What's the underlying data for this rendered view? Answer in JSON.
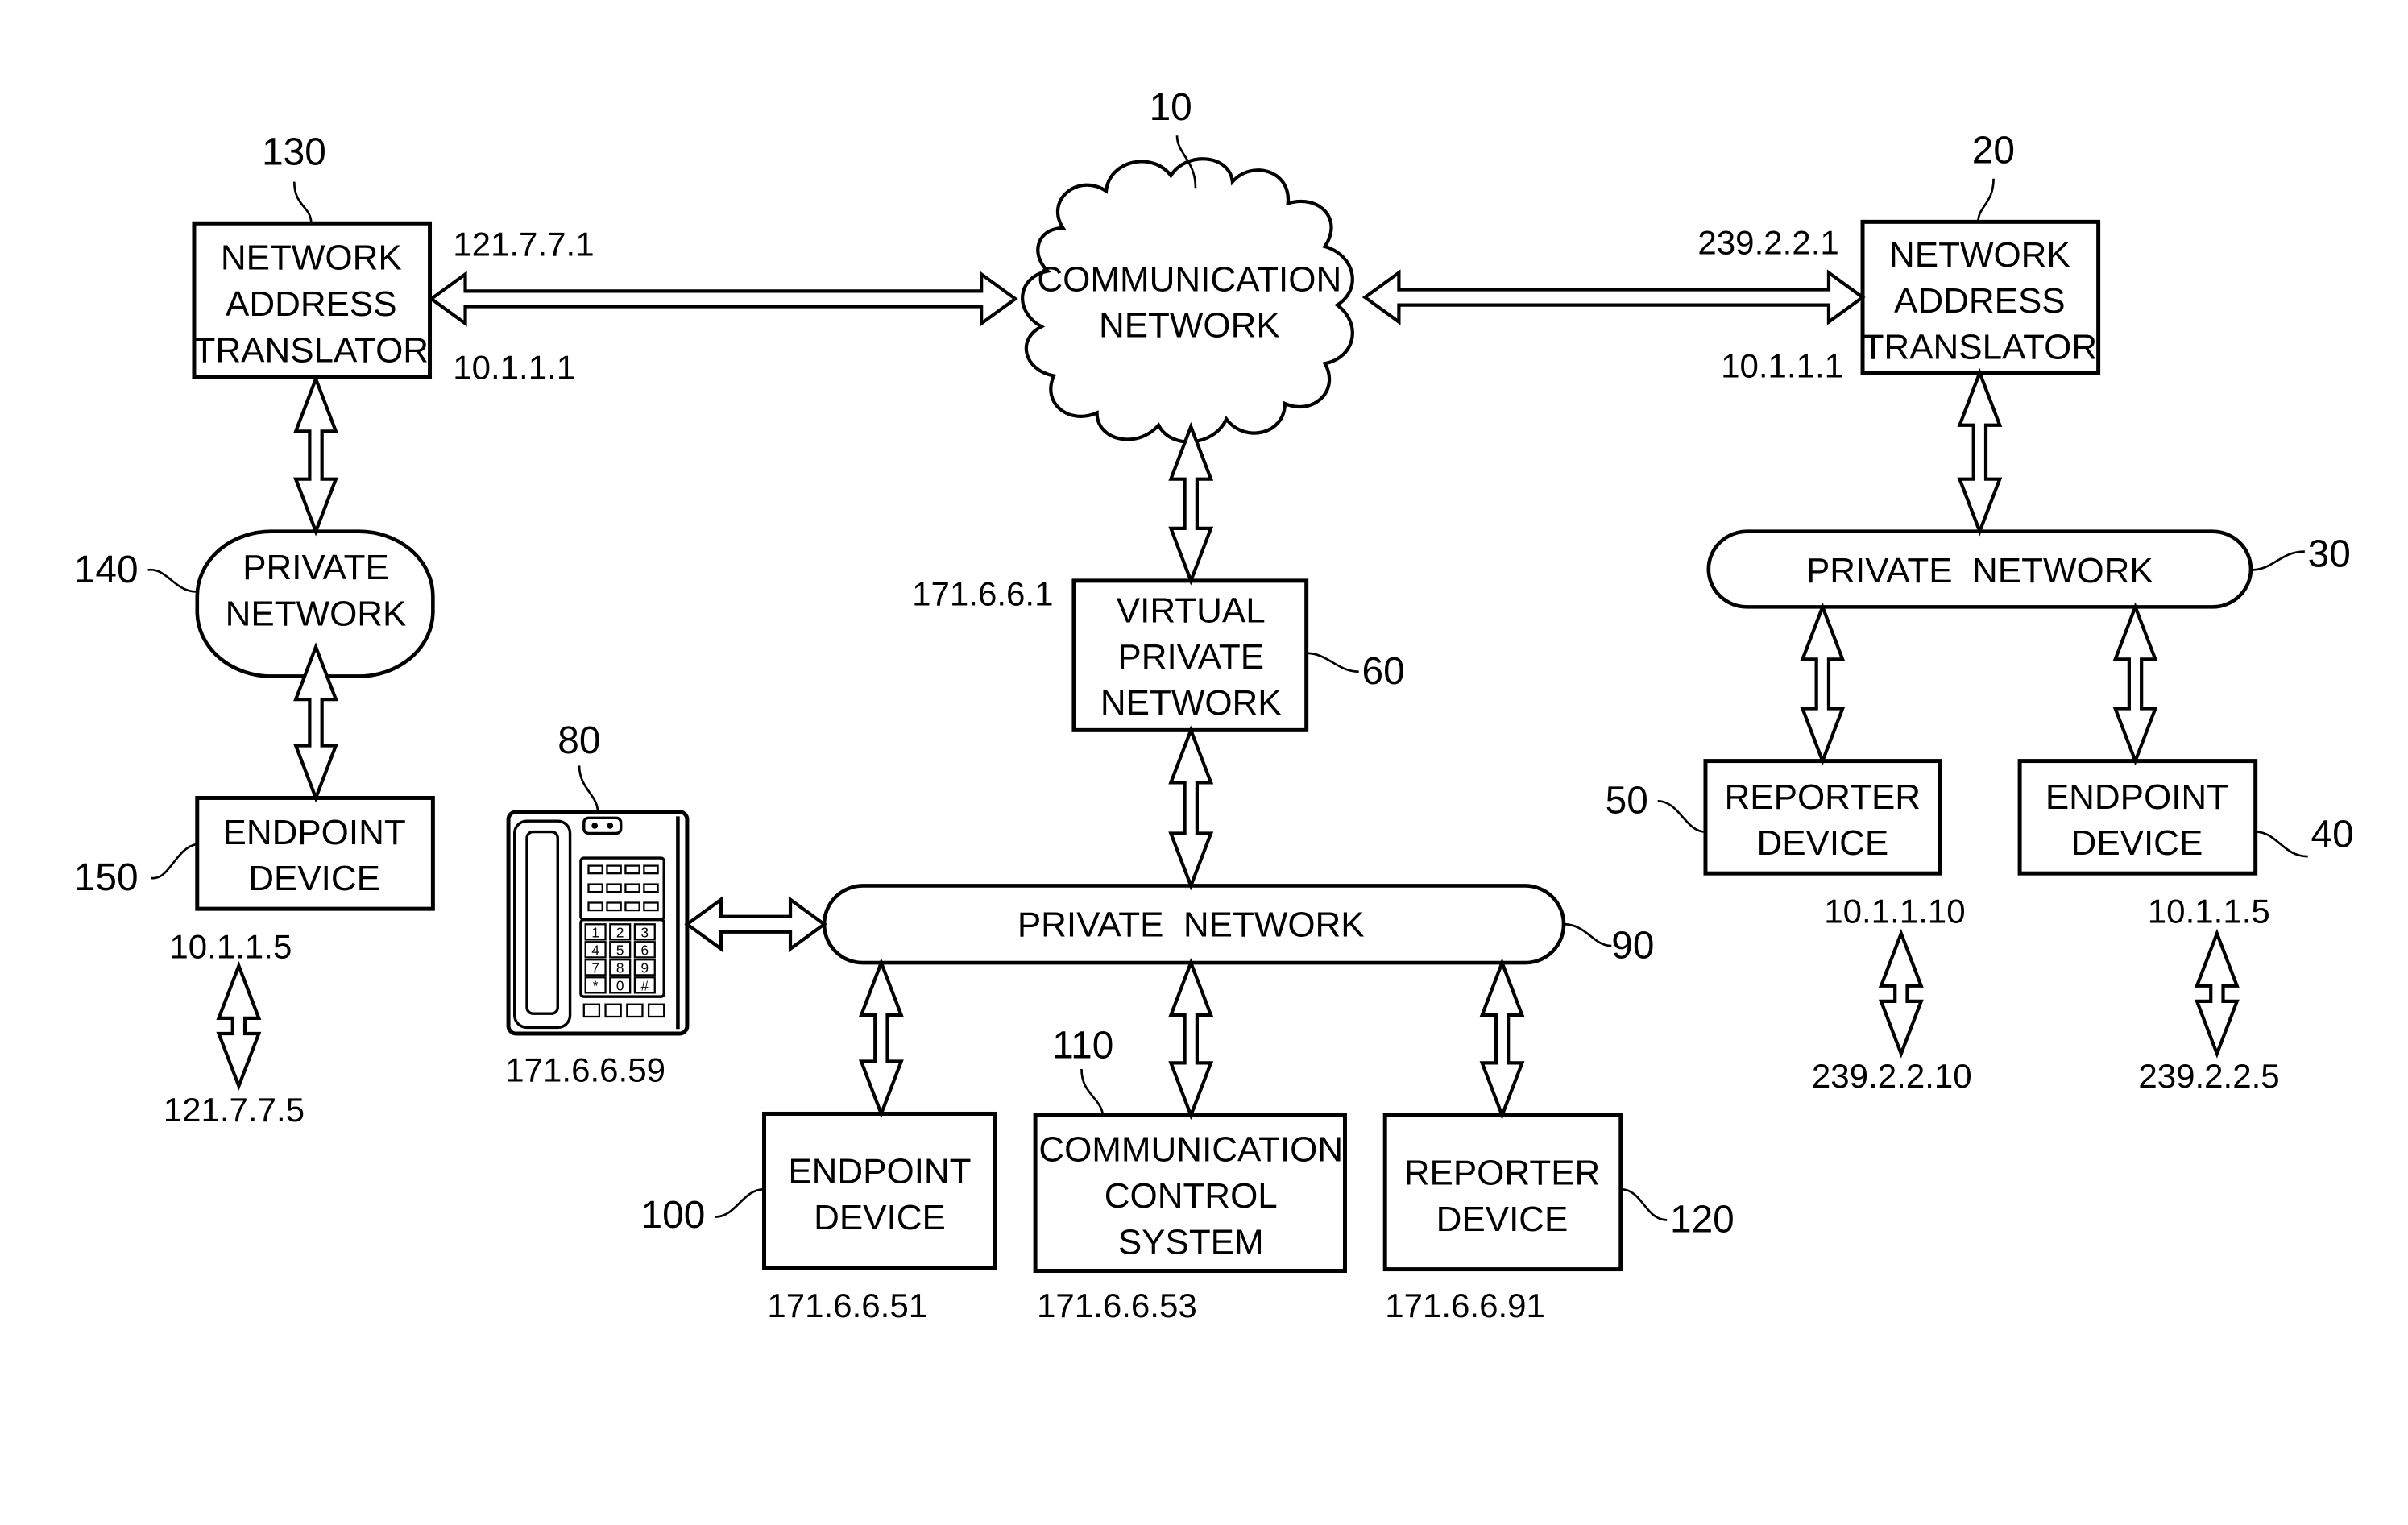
{
  "nodes": {
    "communication_network": {
      "ref": "10",
      "lines": [
        "COMMUNICATION",
        "NETWORK"
      ]
    },
    "nat_right": {
      "ref": "20",
      "lines": [
        "NETWORK",
        "ADDRESS",
        "TRANSLATOR"
      ],
      "ip_public": "239.2.2.1",
      "ip_private": "10.1.1.1"
    },
    "private_network_right": {
      "ref": "30",
      "lines": [
        "PRIVATE  NETWORK"
      ]
    },
    "endpoint_right": {
      "ref": "40",
      "lines": [
        "ENDPOINT",
        "DEVICE"
      ],
      "ip_private": "10.1.1.5",
      "ip_public": "239.2.2.5"
    },
    "reporter_right": {
      "ref": "50",
      "lines": [
        "REPORTER",
        "DEVICE"
      ],
      "ip_private": "10.1.1.10",
      "ip_public": "239.2.2.10"
    },
    "vpn": {
      "ref": "60",
      "lines": [
        "VIRTUAL",
        "PRIVATE",
        "NETWORK"
      ],
      "ip": "171.6.6.1"
    },
    "phone": {
      "ref": "80",
      "ip": "171.6.6.59",
      "keys": [
        "1",
        "2",
        "3",
        "4",
        "5",
        "6",
        "7",
        "8",
        "9",
        "*",
        "0",
        "#"
      ]
    },
    "private_network_center": {
      "ref": "90",
      "lines": [
        "PRIVATE  NETWORK"
      ]
    },
    "endpoint_center": {
      "ref": "100",
      "lines": [
        "ENDPOINT",
        "DEVICE"
      ],
      "ip": "171.6.6.51"
    },
    "comm_control": {
      "ref": "110",
      "lines": [
        "COMMUNICATION",
        "CONTROL",
        "SYSTEM"
      ],
      "ip": "171.6.6.53"
    },
    "reporter_center": {
      "ref": "120",
      "lines": [
        "REPORTER",
        "DEVICE"
      ],
      "ip": "171.6.6.91"
    },
    "nat_left": {
      "ref": "130",
      "lines": [
        "NETWORK",
        "ADDRESS",
        "TRANSLATOR"
      ],
      "ip_public": "121.7.7.1",
      "ip_private": "10.1.1.1"
    },
    "private_network_left": {
      "ref": "140",
      "lines": [
        "PRIVATE",
        "NETWORK"
      ]
    },
    "endpoint_left": {
      "ref": "150",
      "lines": [
        "ENDPOINT",
        "DEVICE"
      ],
      "ip_private": "10.1.1.5",
      "ip_public": "121.7.7.5"
    }
  }
}
